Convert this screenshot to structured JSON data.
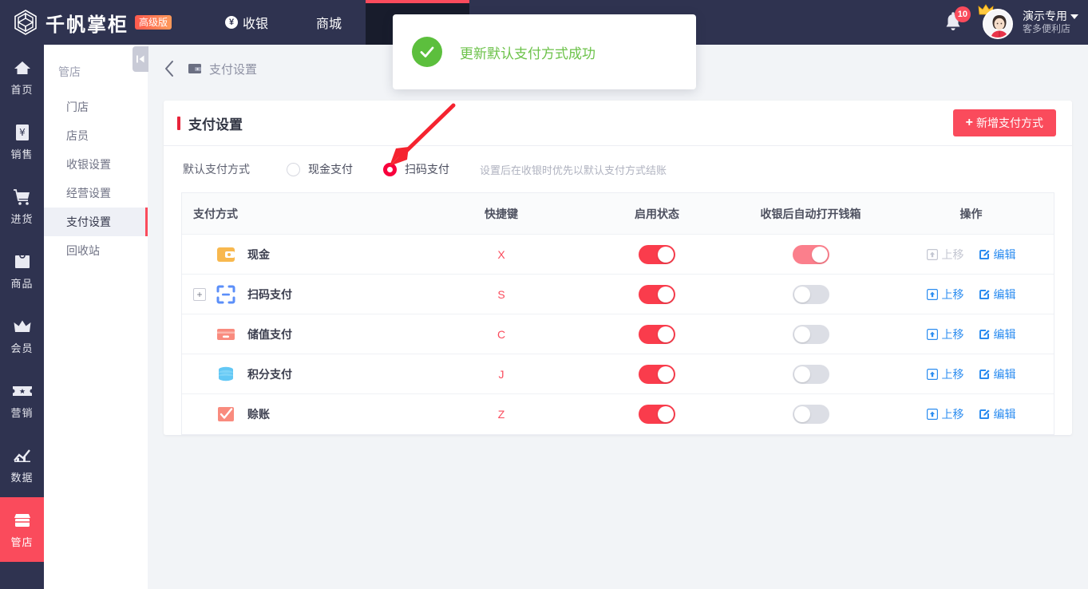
{
  "header": {
    "logo_text": "千帆掌柜",
    "logo_badge": "高级版",
    "nav": [
      {
        "label": "收银",
        "icon": "coin-icon",
        "active": false
      },
      {
        "label": "商城",
        "icon": "",
        "active": false
      },
      {
        "label": "",
        "icon": "",
        "active": true
      }
    ],
    "notifications_count": "10",
    "user_name": "演示专用",
    "user_store": "客多便利店"
  },
  "rail": {
    "items": [
      {
        "label": "首页",
        "icon": "home-icon",
        "active": false
      },
      {
        "label": "销售",
        "icon": "sales-icon",
        "active": false
      },
      {
        "label": "进货",
        "icon": "purchase-cart-icon",
        "active": false
      },
      {
        "label": "商品",
        "icon": "goods-box-icon",
        "active": false
      },
      {
        "label": "会员",
        "icon": "crown-member-icon",
        "active": false
      },
      {
        "label": "营销",
        "icon": "ticket-icon",
        "active": false
      },
      {
        "label": "数据",
        "icon": "chart-icon",
        "active": false
      },
      {
        "label": "管店",
        "icon": "shop-icon",
        "active": true
      }
    ]
  },
  "submenu": {
    "title": "管店",
    "items": [
      {
        "label": "门店",
        "active": false
      },
      {
        "label": "店员",
        "active": false
      },
      {
        "label": "收银设置",
        "active": false
      },
      {
        "label": "经营设置",
        "active": false
      },
      {
        "label": "支付设置",
        "active": true
      },
      {
        "label": "回收站",
        "active": false
      }
    ]
  },
  "breadcrumb": {
    "back_icon": "chevron-left-icon",
    "icon": "wallet-icon",
    "text": "支付设置"
  },
  "card": {
    "title": "支付设置",
    "add_button": "新增支付方式",
    "add_button_plus": "+"
  },
  "default_payment": {
    "label": "默认支付方式",
    "options": [
      {
        "label": "现金支付",
        "checked": false
      },
      {
        "label": "扫码支付",
        "checked": true
      }
    ],
    "hint": "设置后在收银时优先以默认支付方式结账"
  },
  "table": {
    "columns": [
      "支付方式",
      "快捷键",
      "启用状态",
      "收银后自动打开钱箱",
      "操作"
    ],
    "rows": [
      {
        "name": "现金",
        "icon": "wallet-cash-icon",
        "shortcut": "X",
        "enabled": true,
        "drawer": true,
        "drawer_muted": true,
        "expandable": false,
        "move_up": "上移",
        "move_up_disabled": true,
        "edit": "编辑"
      },
      {
        "name": "扫码支付",
        "icon": "scan-qr-icon",
        "shortcut": "S",
        "enabled": true,
        "drawer": false,
        "drawer_muted": false,
        "expandable": true,
        "move_up": "上移",
        "move_up_disabled": false,
        "edit": "编辑"
      },
      {
        "name": "储值支付",
        "icon": "stored-card-icon",
        "shortcut": "C",
        "enabled": true,
        "drawer": false,
        "drawer_muted": false,
        "expandable": false,
        "move_up": "上移",
        "move_up_disabled": false,
        "edit": "编辑"
      },
      {
        "name": "积分支付",
        "icon": "points-stack-icon",
        "shortcut": "J",
        "enabled": true,
        "drawer": false,
        "drawer_muted": false,
        "expandable": false,
        "move_up": "上移",
        "move_up_disabled": false,
        "edit": "编辑"
      },
      {
        "name": "赊账",
        "icon": "credit-check-icon",
        "shortcut": "Z",
        "enabled": true,
        "drawer": false,
        "drawer_muted": false,
        "expandable": false,
        "move_up": "上移",
        "move_up_disabled": false,
        "edit": "编辑"
      }
    ]
  },
  "toast": {
    "icon": "success-check-icon",
    "message": "更新默认支付方式成功"
  },
  "annotation": {
    "arrow": "red-arrow-pointer"
  },
  "colors": {
    "brand_red": "#fa4b5c",
    "header_bg": "#2f3350",
    "link_blue": "#2b8cf0",
    "success_green": "#6cc24a",
    "toggle_on": "#fa3c4c"
  }
}
